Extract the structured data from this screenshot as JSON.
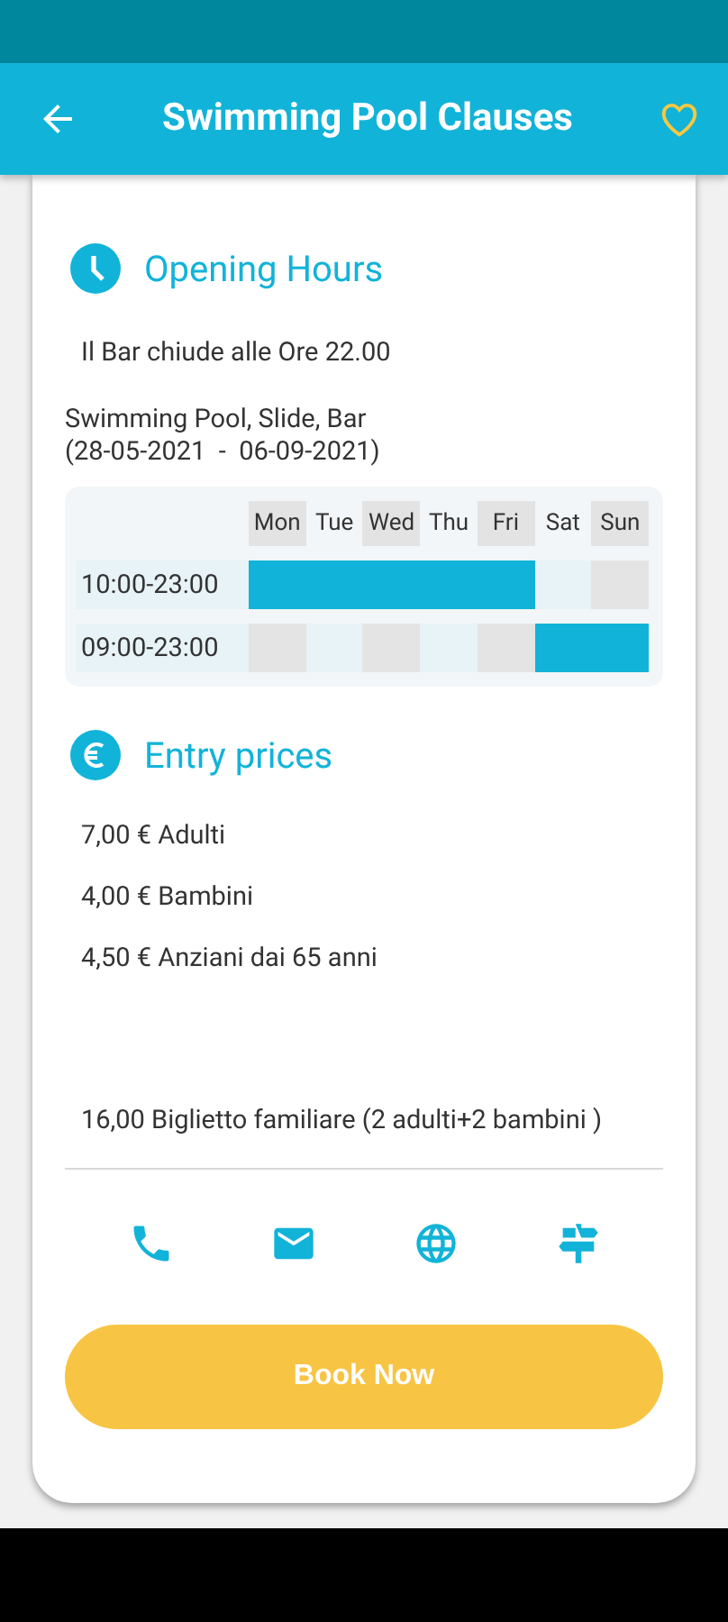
{
  "app_bar": {
    "title": "Swimming Pool Clauses",
    "favorite": false
  },
  "opening_hours": {
    "heading": "Opening Hours",
    "note": "Il Bar chiude alle Ore 22.00",
    "facilities": "Swimming Pool, Slide, Bar",
    "period": "(28-05-2021  -  06-09-2021)",
    "days": [
      "Mon",
      "Tue",
      "Wed",
      "Thu",
      "Fri",
      "Sat",
      "Sun"
    ],
    "rows": [
      {
        "time": "10:00-23:00",
        "open": [
          true,
          true,
          true,
          true,
          true,
          false,
          false
        ]
      },
      {
        "time": "09:00-23:00",
        "open": [
          false,
          false,
          false,
          false,
          false,
          true,
          true
        ]
      }
    ]
  },
  "entry_prices": {
    "heading": "Entry prices",
    "items": [
      "7,00 € Adulti",
      "4,00 € Bambini",
      "4,50 € Anziani dai 65 anni",
      "16,00 Biglietto familiare (2 adulti+2 bambini )"
    ]
  },
  "contact_actions": [
    {
      "kind": "phone"
    },
    {
      "kind": "email"
    },
    {
      "kind": "website"
    },
    {
      "kind": "directions"
    }
  ],
  "book_button": "Book Now"
}
